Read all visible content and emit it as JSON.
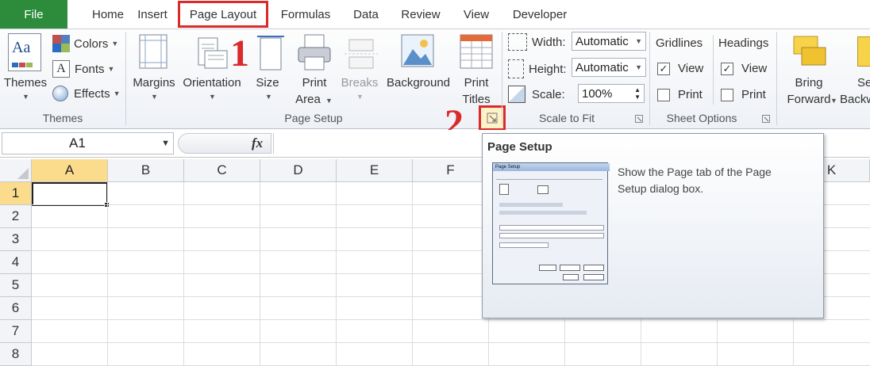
{
  "tabs": {
    "file": "File",
    "home": "Home",
    "insert": "Insert",
    "page_layout": "Page Layout",
    "formulas": "Formulas",
    "data": "Data",
    "review": "Review",
    "view": "View",
    "developer": "Developer"
  },
  "ribbon": {
    "themes_group": {
      "label": "Themes",
      "themes_button": "Themes",
      "colors": "Colors",
      "fonts": "Fonts",
      "effects": "Effects"
    },
    "page_setup_group": {
      "label": "Page Setup",
      "margins": "Margins",
      "orientation": "Orientation",
      "size": "Size",
      "print_area_1": "Print",
      "print_area_2": "Area",
      "breaks": "Breaks",
      "background": "Background",
      "print_titles_1": "Print",
      "print_titles_2": "Titles"
    },
    "scale_group": {
      "label": "Scale to Fit",
      "width_label": "Width:",
      "width_value": "Automatic",
      "height_label": "Height:",
      "height_value": "Automatic",
      "scale_label": "Scale:",
      "scale_value": "100%"
    },
    "sheet_options_group": {
      "label": "Sheet Options",
      "gridlines": "Gridlines",
      "headings": "Headings",
      "view": "View",
      "print": "Print"
    },
    "arrange_group": {
      "bring_1": "Bring",
      "bring_2": "Forward",
      "send_1": "Se",
      "send_2": "Backw"
    }
  },
  "annotations": {
    "step1": "1",
    "step2": "2"
  },
  "formula_bar": {
    "name_box": "A1",
    "fx": "fx",
    "formula": ""
  },
  "grid": {
    "columns": [
      "A",
      "B",
      "C",
      "D",
      "E",
      "F",
      "K"
    ],
    "rows": [
      "1",
      "2",
      "3",
      "4",
      "5",
      "6",
      "7",
      "8"
    ],
    "selected_cell": "A1"
  },
  "tooltip": {
    "title": "Page Setup",
    "description": "Show the Page tab of the Page Setup dialog box.",
    "preview_title": "Page Setup"
  },
  "colors": {
    "file_tab": "#2c8c3c",
    "highlight_red": "#d92b2b",
    "selected_header": "#fbdc8c"
  }
}
